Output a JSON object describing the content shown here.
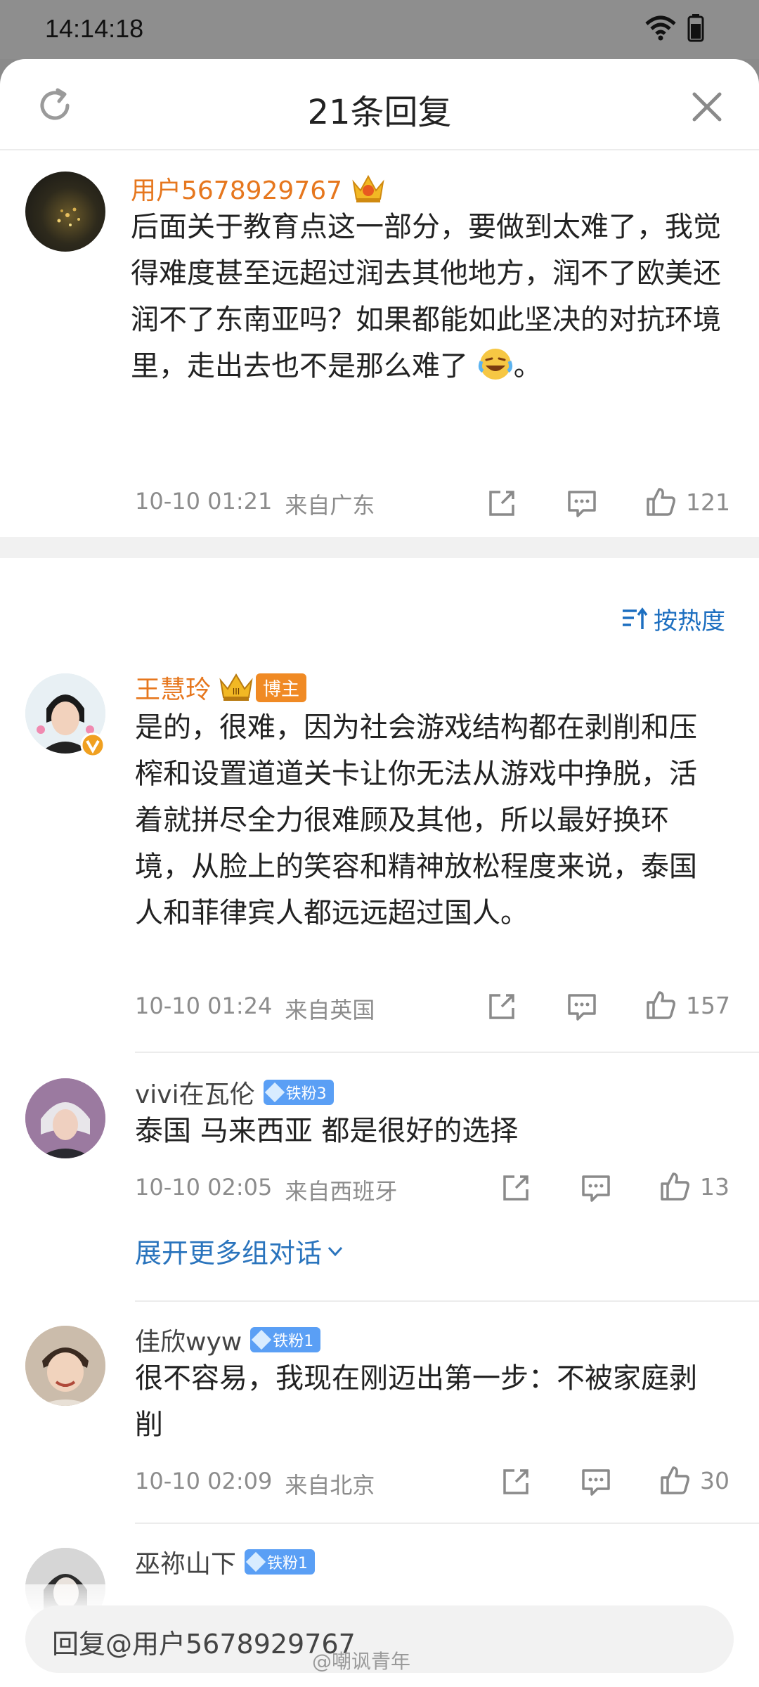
{
  "status_bar": {
    "time": "14:14:18"
  },
  "header": {
    "title": "21条回复"
  },
  "main_comment": {
    "username": "用户5678929767",
    "text": "后面关于教育点这一部分，要做到太难了，我觉得难度甚至远超过润去其他地方，润不了欧美还润不了东南亚吗？如果都能如此坚决的对抗环境里，走出去也不是那么难了",
    "text_end": "。",
    "time": "10-10 01:21",
    "location": "来自广东",
    "likes": "121"
  },
  "sort": {
    "label": "按热度"
  },
  "replies": [
    {
      "username": "王慧玲",
      "tag": "博主",
      "text": "是的，很难，因为社会游戏结构都在剥削和压榨和设置道道关卡让你无法从游戏中挣脱，活着就拼尽全力很难顾及其他，所以最好换环境，从脸上的笑容和精神放松程度来说，泰国人和菲律宾人都远远超过国人。",
      "time": "10-10 01:24",
      "location": "来自英国",
      "likes": "157"
    },
    {
      "username": "vivi在瓦伦",
      "fan_badge": "铁粉3",
      "text": "泰国 马来西亚 都是很好的选择",
      "time": "10-10 02:05",
      "location": "来自西班牙",
      "likes": "13"
    },
    {
      "username": "佳欣wyw",
      "fan_badge": "铁粉1",
      "text": "很不容易，我现在刚迈出第一步：不被家庭剥削",
      "time": "10-10 02:09",
      "location": "来自北京",
      "likes": "30"
    },
    {
      "username": "巫祢山下",
      "fan_badge": "铁粉1"
    }
  ],
  "expand_label": "展开更多组对话",
  "reply_bar": {
    "placeholder": "回复@用户5678929767"
  },
  "watermark": "@嘲讽青年",
  "colors": {
    "username": "#e6771e",
    "link": "#2a74bd",
    "fan_badge": "#5a9ff5"
  }
}
